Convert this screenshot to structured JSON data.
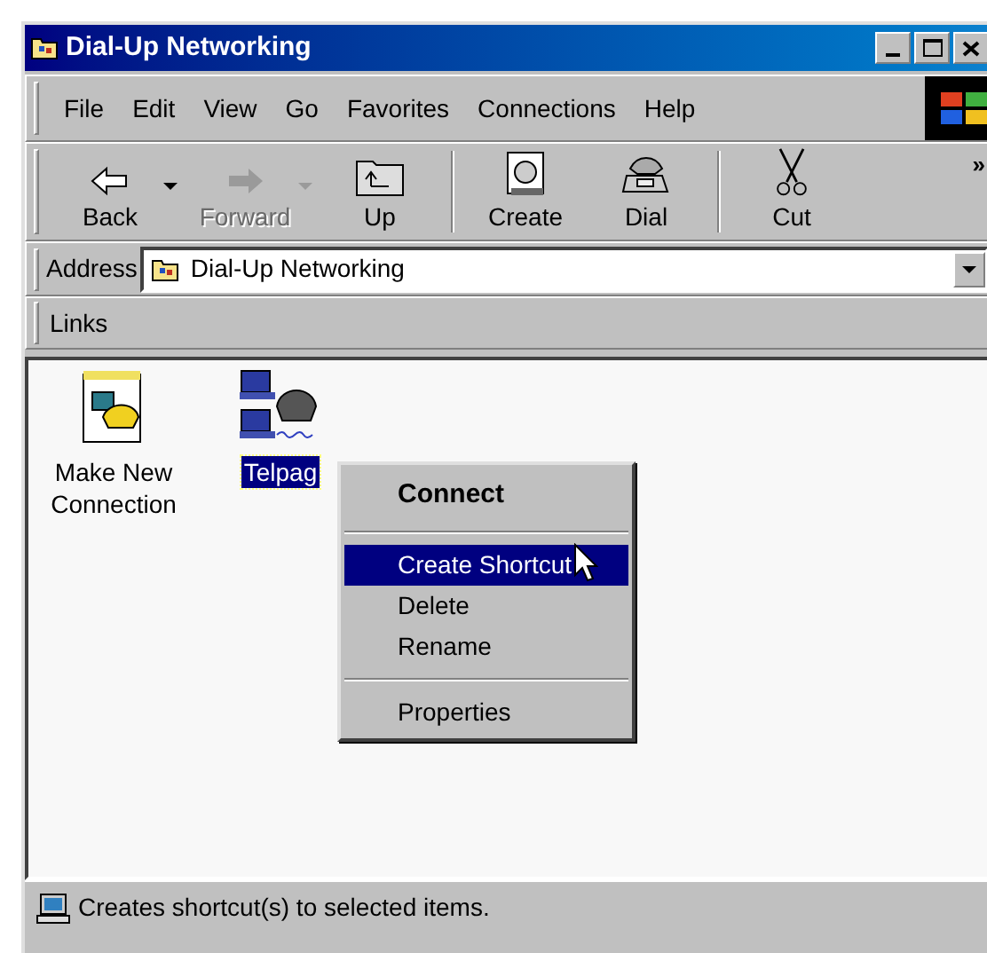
{
  "window": {
    "title": "Dial-Up Networking"
  },
  "menu_bar": [
    {
      "label": "File"
    },
    {
      "label": "Edit"
    },
    {
      "label": "View"
    },
    {
      "label": "Go"
    },
    {
      "label": "Favorites"
    },
    {
      "label": "Connections"
    },
    {
      "label": "Help"
    }
  ],
  "toolbar": [
    {
      "label": "Back",
      "kind": "back",
      "disabled": false,
      "dropdown": true
    },
    {
      "label": "Forward",
      "kind": "forward",
      "disabled": true,
      "dropdown": true
    },
    {
      "label": "Up",
      "kind": "up",
      "disabled": false,
      "dropdown": false
    },
    {
      "label": "Create",
      "kind": "create",
      "disabled": false,
      "dropdown": false
    },
    {
      "label": "Dial",
      "kind": "dial",
      "disabled": false,
      "dropdown": false
    },
    {
      "label": "Cut",
      "kind": "cut",
      "disabled": false,
      "dropdown": false
    }
  ],
  "toolbar_more": "»",
  "address": {
    "label": "Address",
    "value": "Dial-Up Networking"
  },
  "links": {
    "label": "Links"
  },
  "items": [
    {
      "label": "Make New Connection",
      "kind": "new",
      "selected": false
    },
    {
      "label": "Telpag",
      "kind": "connection",
      "selected": true
    }
  ],
  "context_menu": [
    {
      "label": "Connect",
      "kind": "default",
      "selected": false
    },
    {
      "kind": "separator"
    },
    {
      "label": "Create Shortcut",
      "kind": "item",
      "selected": true
    },
    {
      "label": "Delete",
      "kind": "item",
      "selected": false
    },
    {
      "label": "Rename",
      "kind": "item",
      "selected": false
    },
    {
      "kind": "separator"
    },
    {
      "label": "Properties",
      "kind": "item",
      "selected": false
    }
  ],
  "status_bar": {
    "text": "Creates shortcut(s) to selected items."
  }
}
